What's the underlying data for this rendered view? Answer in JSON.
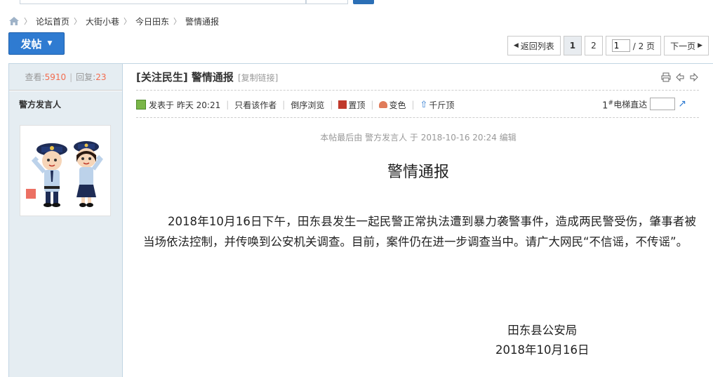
{
  "breadcrumb": {
    "items": [
      "论坛首页",
      "大街小巷",
      "今日田东",
      "警情通报"
    ]
  },
  "toolbar": {
    "post_label": "发帖"
  },
  "pager": {
    "back_label": "返回列表",
    "pages": [
      "1",
      "2"
    ],
    "jump_value": "1",
    "total_label": "/ 2 页",
    "next_label": "下一页"
  },
  "sidebar": {
    "views_label": "查看:",
    "views_value": "5910",
    "replies_label": "回复:",
    "replies_value": "23",
    "author_name": "警方发言人"
  },
  "thread": {
    "title": "[关注民生] 警情通报",
    "copy_link_label": "[复制链接]"
  },
  "post_meta": {
    "posted_label": "发表于 昨天 20:21",
    "author_only_label": "只看该作者",
    "reverse_label": "倒序浏览",
    "top_label": "置顶",
    "color_label": "变色",
    "lift_label": "千斤顶",
    "floor_number": "1",
    "floor_mark": "#",
    "goto_label": "电梯直达"
  },
  "post": {
    "edit_note": "本帖最后由 警方发言人 于 2018-10-16 20:24 编辑",
    "heading": "警情通报",
    "body": "2018年10月16日下午，田东县发生一起民警正常执法遭到暴力袭警事件，造成两民警受伤，肇事者被当场依法控制，并传唤到公安机关调查。目前，案件仍在进一步调查当中。请广大网民“不信谣，不传谣”。",
    "sign_org": "田东县公安局",
    "sign_date": "2018年10月16日"
  },
  "colors": {
    "accent": "#2f7bd1",
    "side_bg": "#e5edf2",
    "number": "#f26c4f"
  }
}
